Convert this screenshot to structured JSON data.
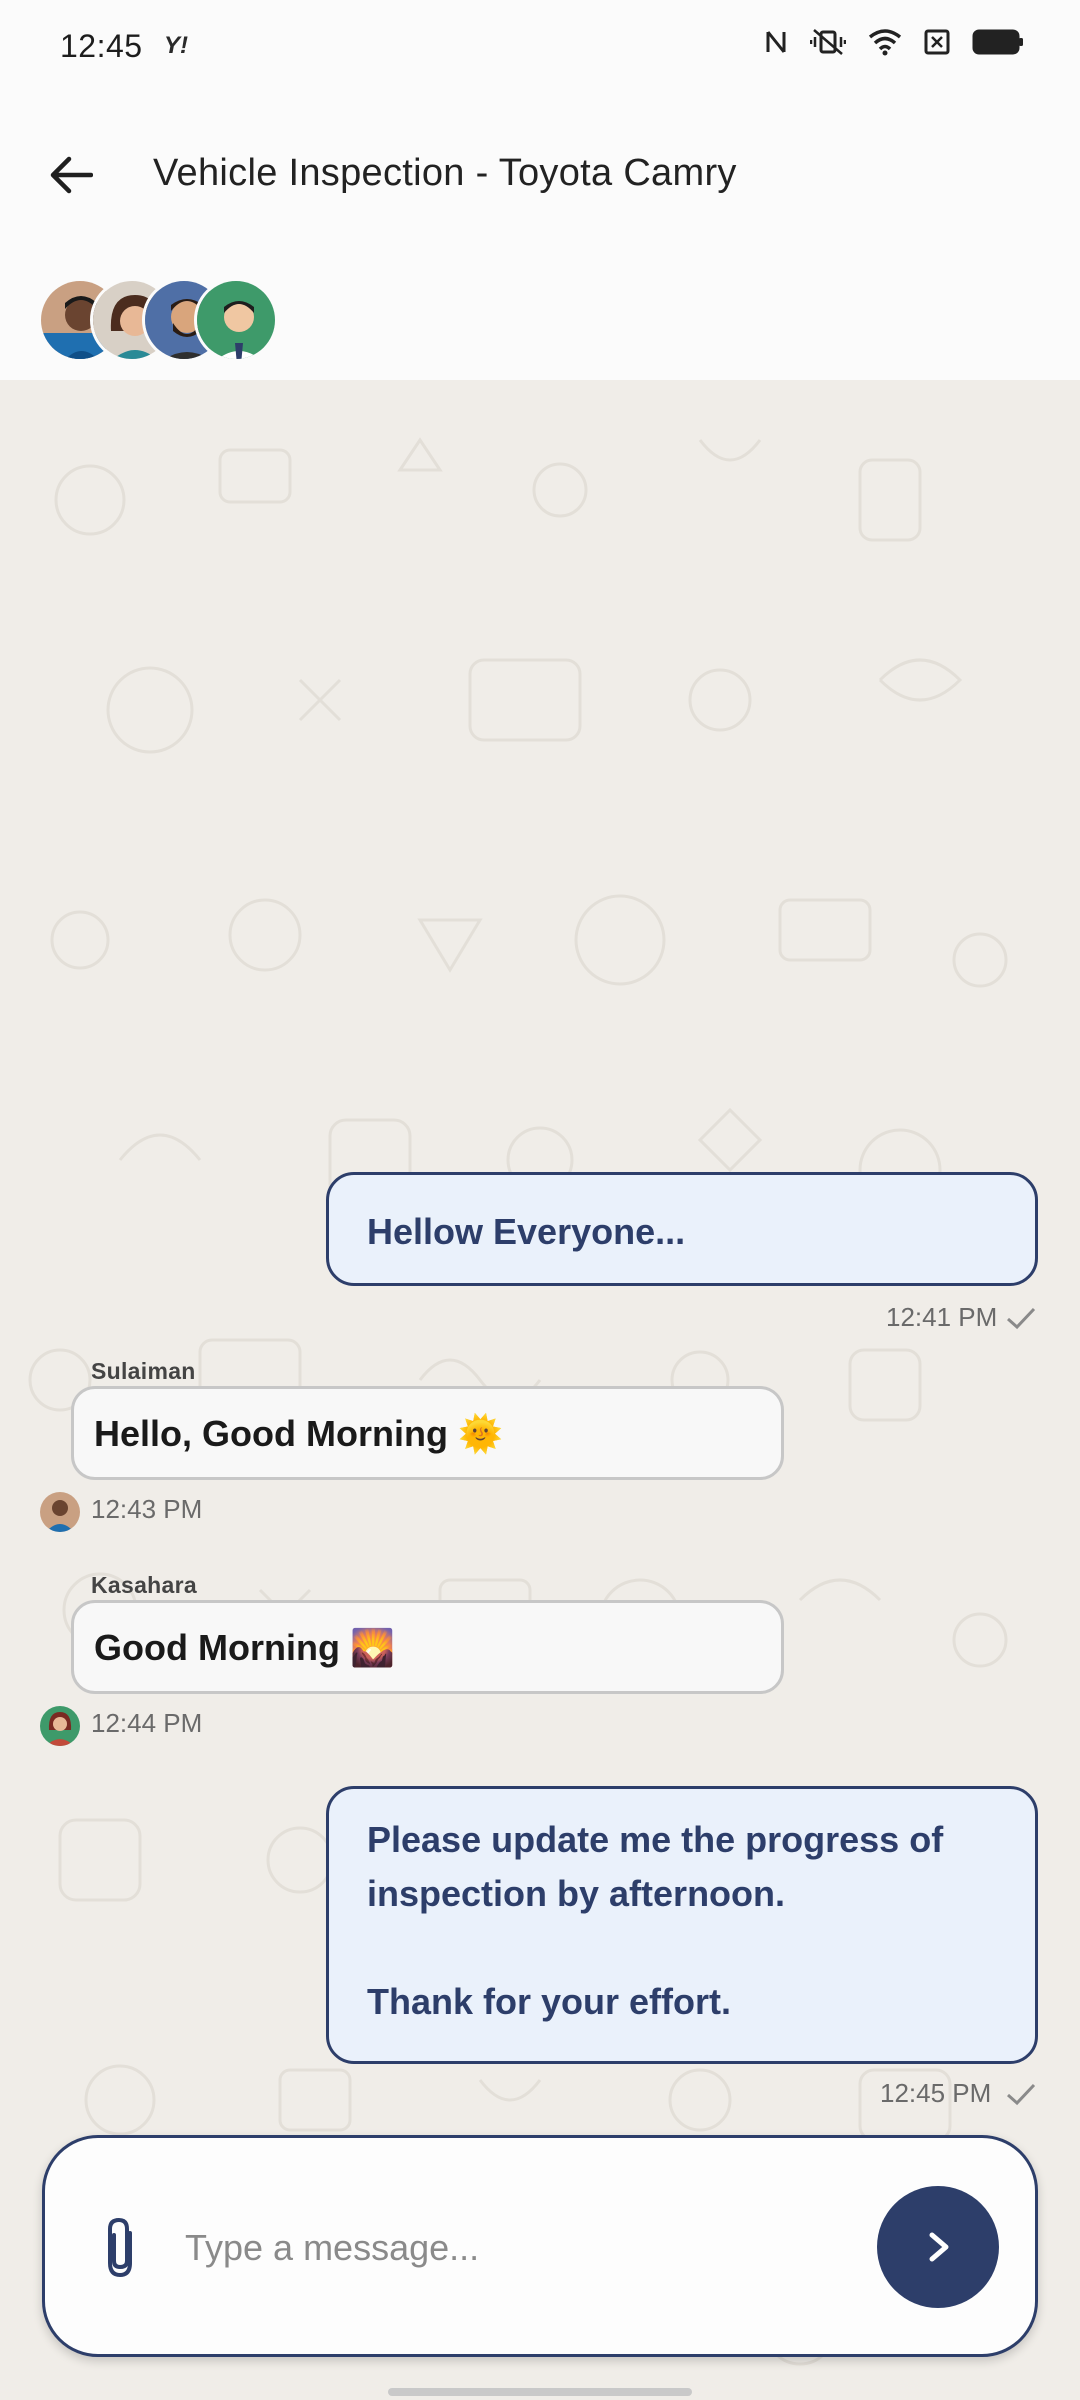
{
  "status_bar": {
    "time": "12:45",
    "yahoo_label": "Y!",
    "icons": [
      "nfc-icon",
      "vibrate-icon",
      "wifi-icon",
      "sim-icon",
      "battery-icon"
    ]
  },
  "header": {
    "title": "Vehicle Inspection - Toyota Camry",
    "back_icon": "arrow-left-icon",
    "participants": [
      "Participant 1",
      "Participant 2",
      "Participant 3",
      "Participant 4"
    ]
  },
  "messages": [
    {
      "direction": "out",
      "text": "Hellow Everyone...",
      "time": "12:41 PM",
      "status": "sent"
    },
    {
      "direction": "in",
      "sender": "Sulaiman",
      "text": "Hello, Good Morning 🌞",
      "time": "12:43 PM"
    },
    {
      "direction": "in",
      "sender": "Kasahara",
      "text": "Good Morning 🌄",
      "time": "12:44 PM"
    },
    {
      "direction": "out",
      "text_line1": "Please update me the progress of",
      "text_line2": "inspection by afternoon.",
      "text_line3": "Thank for your effort.",
      "time": "12:45 PM",
      "status": "sent"
    }
  ],
  "composer": {
    "placeholder": "Type a message...",
    "attach_icon": "paperclip-icon",
    "send_icon": "chevron-right-icon"
  },
  "colors": {
    "accent": "#2d3e6a",
    "outgoing_bubble": "#eaf1fb",
    "incoming_bubble": "#f8f8f8",
    "chat_background": "#f0ede8"
  }
}
